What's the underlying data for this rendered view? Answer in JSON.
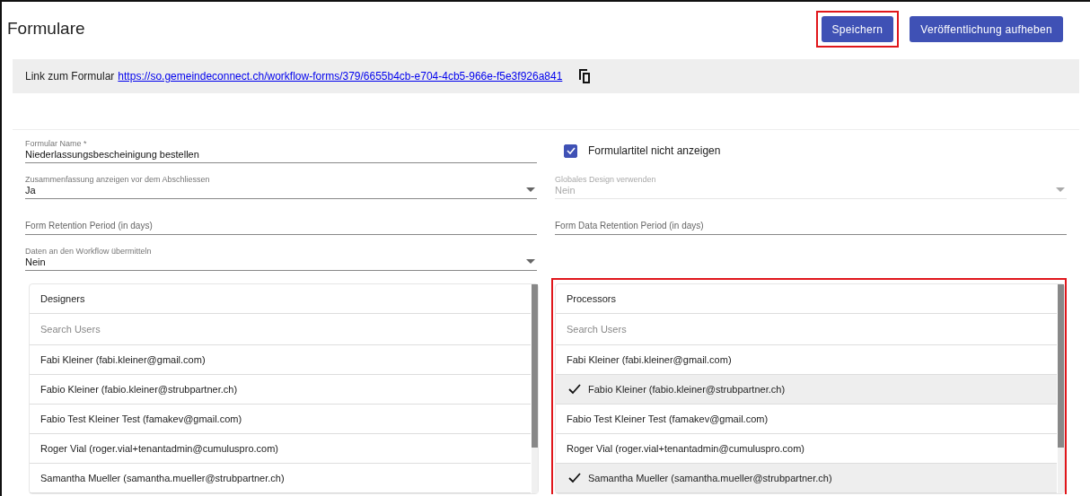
{
  "header": {
    "title": "Formulare",
    "buttons": [
      {
        "label": "Speichern",
        "highlighted": true
      },
      {
        "label": "Veröffentlichung aufheben",
        "highlighted": false
      }
    ]
  },
  "link_bar": {
    "label": "Link zum Formular",
    "url": "https://so.gemeindeconnect.ch/workflow-forms/379/6655b4cb-e704-4cb5-966e-f5e3f926a841"
  },
  "field_rows": [
    [
      {
        "kind": "text",
        "label": "Formular Name *",
        "value": "Niederlassungsbescheinigung bestellen"
      },
      {
        "kind": "checkbox",
        "label": "Formulartitel nicht anzeigen",
        "checked": true
      }
    ],
    [
      {
        "kind": "select",
        "label": "Zusammenfassung anzeigen vor dem Abschliessen",
        "value": "Ja",
        "disabled": false
      },
      {
        "kind": "select",
        "label": "Globales Design verwenden",
        "value": "Nein",
        "disabled": true
      }
    ],
    [
      {
        "kind": "text",
        "placeholder": "Form Retention Period (in days)"
      },
      {
        "kind": "text",
        "placeholder": "Form Data Retention Period (in days)"
      }
    ],
    [
      {
        "kind": "select",
        "label": "Daten an den Workflow übermitteln",
        "value": "Nein",
        "disabled": false
      }
    ]
  ],
  "user_lists": [
    {
      "title": "Designers",
      "search_placeholder": "Search Users",
      "highlighted": false,
      "users": [
        {
          "name": "Fabi Kleiner (fabi.kleiner@gmail.com)",
          "selected": false
        },
        {
          "name": "Fabio Kleiner (fabio.kleiner@strubpartner.ch)",
          "selected": false
        },
        {
          "name": "Fabio Test Kleiner Test (famakev@gmail.com)",
          "selected": false
        },
        {
          "name": "Roger Vial (roger.vial+tenantadmin@cumuluspro.com)",
          "selected": false
        },
        {
          "name": "Samantha Mueller (samantha.mueller@strubpartner.ch)",
          "selected": false
        }
      ]
    },
    {
      "title": "Processors",
      "search_placeholder": "Search Users",
      "highlighted": true,
      "users": [
        {
          "name": "Fabi Kleiner (fabi.kleiner@gmail.com)",
          "selected": false
        },
        {
          "name": "Fabio Kleiner (fabio.kleiner@strubpartner.ch)",
          "selected": true
        },
        {
          "name": "Fabio Test Kleiner Test (famakev@gmail.com)",
          "selected": false
        },
        {
          "name": "Roger Vial (roger.vial+tenantadmin@cumuluspro.com)",
          "selected": false
        },
        {
          "name": "Samantha Mueller (samantha.mueller@strubpartner.ch)",
          "selected": true
        }
      ]
    }
  ]
}
